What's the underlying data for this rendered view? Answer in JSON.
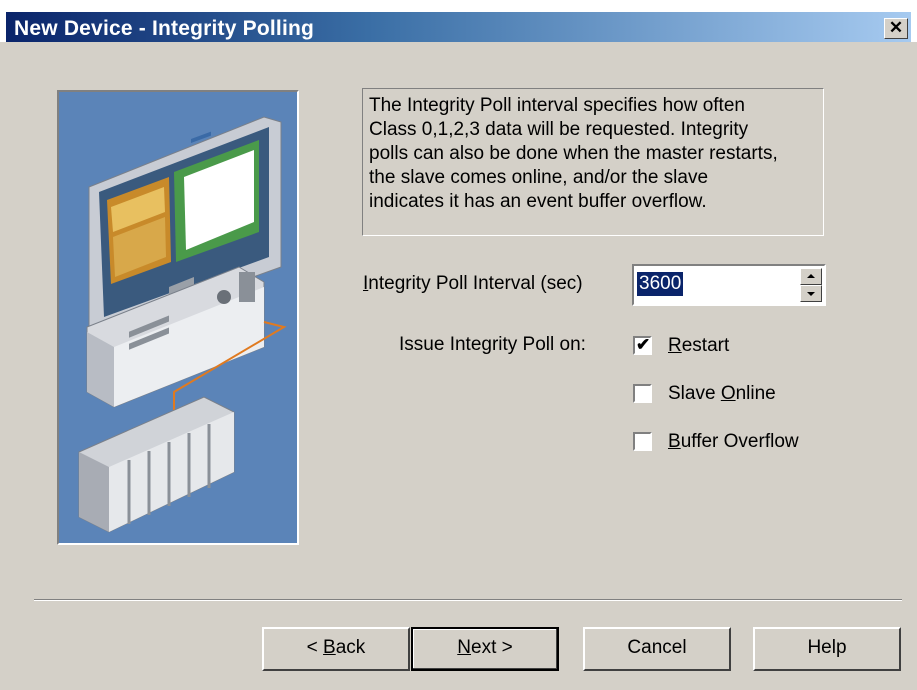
{
  "window": {
    "title": "New Device - Integrity Polling",
    "close_symbol": "✕"
  },
  "help_text": "The Integrity Poll interval specifies how often\nClass 0,1,2,3 data will be requested.   Integrity\npolls can also be done when the master restarts,\nthe slave comes online, and/or the slave\nindicates it has an event buffer overflow.",
  "interval": {
    "label_pre": "",
    "label_mnemonic": "I",
    "label_post": "ntegrity Poll Interval (sec)",
    "value": "3600"
  },
  "issue": {
    "label": "Issue Integrity Poll on:",
    "options": [
      {
        "pre": "",
        "mnemonic": "R",
        "post": "estart",
        "checked": true
      },
      {
        "pre": "Slave ",
        "mnemonic": "O",
        "post": "nline",
        "checked": false
      },
      {
        "pre": "",
        "mnemonic": "B",
        "post": "uffer Overflow",
        "checked": false
      }
    ]
  },
  "buttons": {
    "back": {
      "pre": "< ",
      "mnemonic": "B",
      "post": "ack"
    },
    "next": {
      "pre": "",
      "mnemonic": "N",
      "post": "ext >"
    },
    "cancel": "Cancel",
    "help": "Help"
  },
  "icons": {
    "illustration": "computer-and-plc-illustration",
    "close": "close-icon",
    "spin_up": "spin-up-icon",
    "spin_down": "spin-down-icon",
    "check": "check-icon"
  }
}
